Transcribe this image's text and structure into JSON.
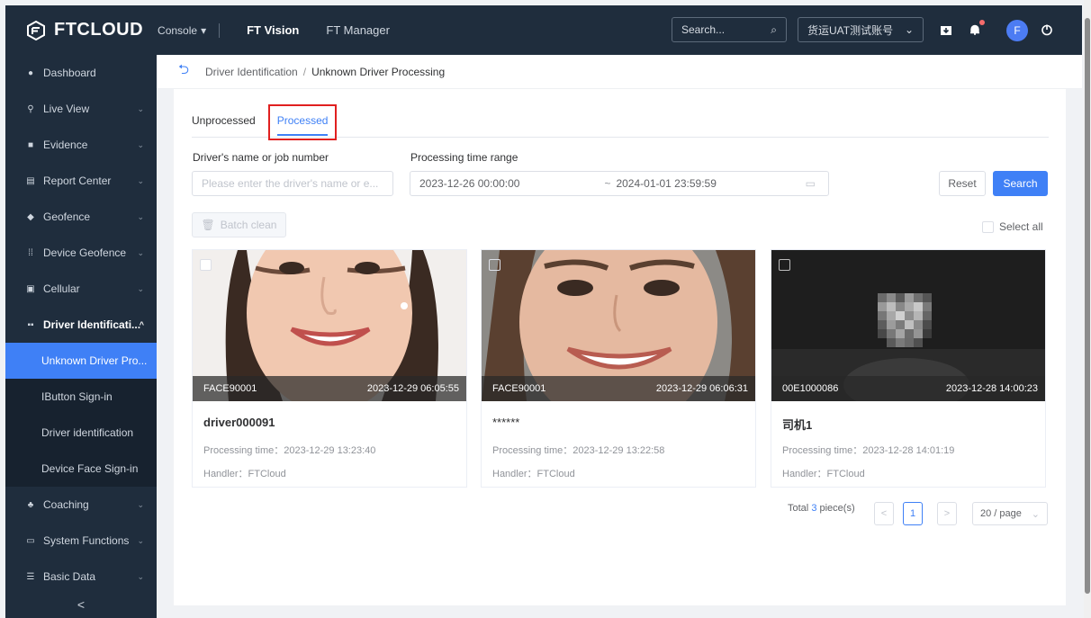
{
  "topbar": {
    "brand": "FTCLOUD",
    "console_label": "Console",
    "nav": [
      "FT Vision",
      "FT Manager"
    ],
    "search_placeholder": "Search...",
    "account": "货运UAT测试账号",
    "avatar_initial": "F"
  },
  "sidebar": {
    "items": [
      {
        "label": "Dashboard",
        "icon": "dashboard-icon"
      },
      {
        "label": "Live View",
        "icon": "live-view-icon"
      },
      {
        "label": "Evidence",
        "icon": "evidence-icon"
      },
      {
        "label": "Report Center",
        "icon": "report-icon"
      },
      {
        "label": "Geofence",
        "icon": "geofence-icon"
      },
      {
        "label": "Device Geofence",
        "icon": "device-geofence-icon"
      },
      {
        "label": "Cellular",
        "icon": "cellular-icon"
      },
      {
        "label": "Driver Identificati...",
        "icon": "driver-id-icon"
      }
    ],
    "subitems": [
      "Unknown Driver Pro...",
      "IButton Sign-in",
      "Driver identification",
      "Device Face Sign-in"
    ],
    "after_items": [
      {
        "label": "Coaching",
        "icon": "coaching-icon"
      },
      {
        "label": "System Functions",
        "icon": "system-icon"
      },
      {
        "label": "Basic Data",
        "icon": "basic-data-icon"
      }
    ],
    "collapse_symbol": "<"
  },
  "breadcrumb": {
    "parent": "Driver Identification",
    "separator": "/",
    "current": "Unknown Driver Processing"
  },
  "tabs": [
    "Unprocessed",
    "Processed"
  ],
  "filters": {
    "driver_label": "Driver's name or job number",
    "driver_placeholder": "Please enter the driver's name or e...",
    "time_label": "Processing time range",
    "start": "2023-12-26 00:00:00",
    "tilde": "~",
    "end": "2024-01-01 23:59:59",
    "reset": "Reset",
    "search": "Search"
  },
  "batch_clean": "Batch clean",
  "select_all": "Select all",
  "cards": [
    {
      "device": "FACE90001",
      "time": "2023-12-29 06:05:55",
      "name": "driver000091",
      "processing": "Processing time：2023-12-29 13:23:40",
      "handler": "Handler：FTCloud"
    },
    {
      "device": "FACE90001",
      "time": "2023-12-29 06:06:31",
      "name": "******",
      "processing": "Processing time：2023-12-29 13:22:58",
      "handler": "Handler：FTCloud"
    },
    {
      "device": "00E1000086",
      "time": "2023-12-28 14:00:23",
      "name": "司机1",
      "processing": "Processing time：2023-12-28 14:01:19",
      "handler": "Handler：FTCloud"
    }
  ],
  "pagination": {
    "total_prefix": "Total",
    "total": "3",
    "total_suffix": "piece(s)",
    "prev": "<",
    "page": "1",
    "next": ">",
    "page_size": "20 / page"
  }
}
